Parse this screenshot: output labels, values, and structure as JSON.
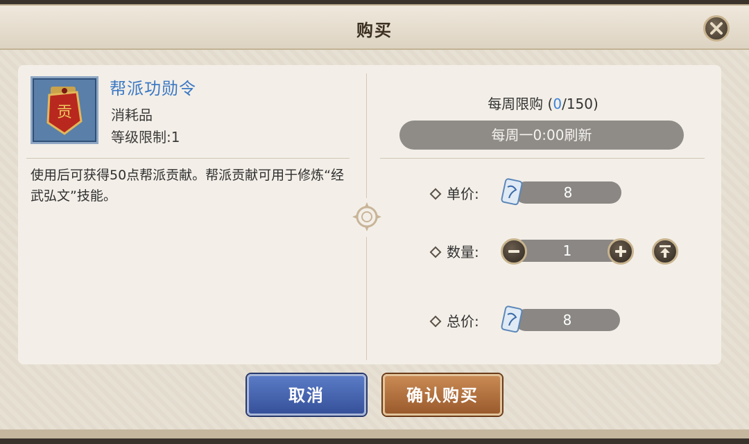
{
  "dialog": {
    "title": "购买",
    "close_icon": "close-icon"
  },
  "item": {
    "name": "帮派功勋令",
    "type": "消耗品",
    "level_limit": "等级限制:1",
    "description": "使用后可获得50点帮派贡献。帮派贡献可用于修炼“经武弘文”技能。",
    "icon": "token-plaque-icon",
    "icon_glyph": "贡"
  },
  "purchase": {
    "weekly_limit_label": "每周限购 (",
    "weekly_current": "0",
    "weekly_max": "/150)",
    "refresh_text": "每周一0:00刷新",
    "unit_price_label": "单价:",
    "unit_price": "8",
    "quantity_label": "数量:",
    "quantity": "1",
    "total_label": "总价:",
    "total_price": "8",
    "currency_icon": "scroll-currency-icon"
  },
  "buttons": {
    "cancel": "取消",
    "confirm": "确认购买"
  },
  "colors": {
    "item_name": "#3b78c4",
    "limit_current": "#3b82d8",
    "cancel_button": "#4565b0",
    "confirm_button": "#b87440"
  }
}
